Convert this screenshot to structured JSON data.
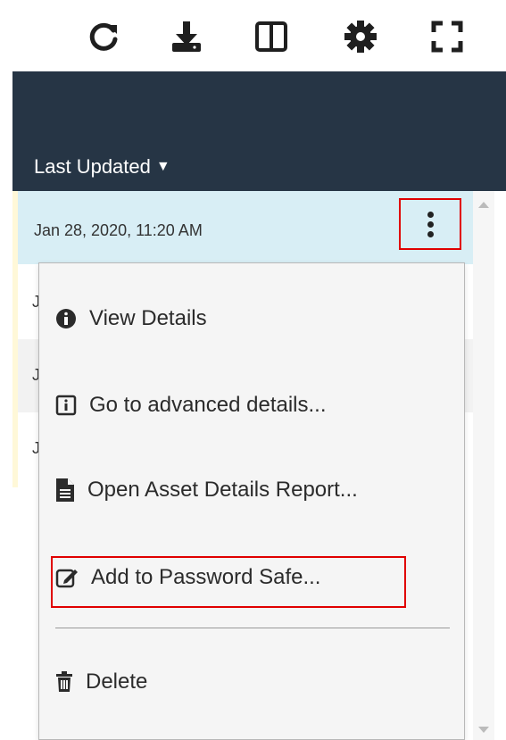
{
  "toolbar": {
    "icons": [
      "refresh-icon",
      "download-icon",
      "columns-icon",
      "gear-icon",
      "fullscreen-icon"
    ]
  },
  "header": {
    "sort_label": "Last Updated",
    "sort_caret": "▼"
  },
  "grid": {
    "selected_row_date": "Jan 28, 2020, 11:20 AM",
    "row_fragments": [
      "J",
      "J",
      "J"
    ]
  },
  "menu": {
    "items": [
      {
        "label": "View Details",
        "icon": "info-circle-icon"
      },
      {
        "label": "Go to advanced details...",
        "icon": "info-square-icon"
      },
      {
        "label": "Open Asset Details Report...",
        "icon": "file-icon"
      },
      {
        "label": "Add to Password Safe...",
        "icon": "edit-icon"
      },
      {
        "label": "Delete",
        "icon": "trash-icon"
      }
    ]
  },
  "colors": {
    "header_bg": "#263545",
    "selected_row_bg": "#d8eef5",
    "highlight_border": "#e00000",
    "menu_bg": "#f5f5f5"
  }
}
